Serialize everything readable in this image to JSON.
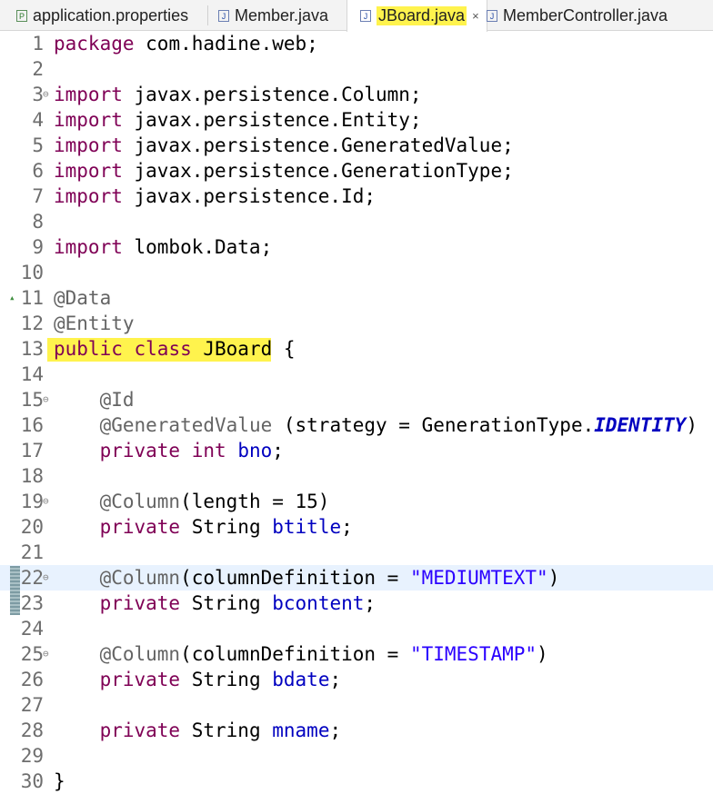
{
  "tabs": [
    {
      "label": "application.properties",
      "icon": "properties-file-icon",
      "icon_glyph": "P"
    },
    {
      "label": "Member.java",
      "icon": "java-file-icon",
      "icon_glyph": "J"
    },
    {
      "label": "JBoard.java",
      "icon": "java-file-icon",
      "icon_glyph": "J",
      "close": "×"
    },
    {
      "label": "MemberController.java",
      "icon": "java-file-icon",
      "icon_glyph": "J"
    }
  ],
  "lines": [
    {
      "n": "1",
      "tokens": [
        [
          "kw",
          "package"
        ],
        [
          "plain",
          " com.hadine.web;"
        ]
      ]
    },
    {
      "n": "2",
      "tokens": []
    },
    {
      "n": "3",
      "fold": "⊖",
      "tokens": [
        [
          "kw",
          "import"
        ],
        [
          "plain",
          " javax.persistence.Column;"
        ]
      ]
    },
    {
      "n": "4",
      "tokens": [
        [
          "kw",
          "import"
        ],
        [
          "plain",
          " javax.persistence.Entity;"
        ]
      ]
    },
    {
      "n": "5",
      "tokens": [
        [
          "kw",
          "import"
        ],
        [
          "plain",
          " javax.persistence.GeneratedValue;"
        ]
      ]
    },
    {
      "n": "6",
      "tokens": [
        [
          "kw",
          "import"
        ],
        [
          "plain",
          " javax.persistence.GenerationType;"
        ]
      ]
    },
    {
      "n": "7",
      "tokens": [
        [
          "kw",
          "import"
        ],
        [
          "plain",
          " javax.persistence.Id;"
        ]
      ]
    },
    {
      "n": "8",
      "tokens": []
    },
    {
      "n": "9",
      "tokens": [
        [
          "kw",
          "import"
        ],
        [
          "plain",
          " lombok.Data;"
        ]
      ]
    },
    {
      "n": "10",
      "tokens": []
    },
    {
      "n": "11",
      "foldUp": "▴",
      "tokens": [
        [
          "ann",
          "@Data"
        ]
      ]
    },
    {
      "n": "12",
      "tokens": [
        [
          "ann",
          "@Entity"
        ]
      ]
    },
    {
      "n": "13",
      "tokens": [
        [
          "kw",
          "public"
        ],
        [
          "plain",
          " "
        ],
        [
          "kw",
          "class"
        ],
        [
          "plain",
          " JBoard {"
        ]
      ]
    },
    {
      "n": "14",
      "tokens": []
    },
    {
      "n": "15",
      "fold": "⊖",
      "tokens": [
        [
          "plain",
          "    "
        ],
        [
          "ann",
          "@Id"
        ]
      ]
    },
    {
      "n": "16",
      "tokens": [
        [
          "plain",
          "    "
        ],
        [
          "ann",
          "@GeneratedValue"
        ],
        [
          "plain",
          " (strategy = GenerationType."
        ],
        [
          "konst",
          "IDENTITY"
        ],
        [
          "plain",
          ")"
        ]
      ]
    },
    {
      "n": "17",
      "tokens": [
        [
          "plain",
          "    "
        ],
        [
          "kw",
          "private"
        ],
        [
          "plain",
          " "
        ],
        [
          "kw",
          "int"
        ],
        [
          "plain",
          " "
        ],
        [
          "field",
          "bno"
        ],
        [
          "plain",
          ";"
        ]
      ]
    },
    {
      "n": "18",
      "tokens": []
    },
    {
      "n": "19",
      "fold": "⊖",
      "tokens": [
        [
          "plain",
          "    "
        ],
        [
          "ann",
          "@Column"
        ],
        [
          "plain",
          "(length = 15)"
        ]
      ]
    },
    {
      "n": "20",
      "tokens": [
        [
          "plain",
          "    "
        ],
        [
          "kw",
          "private"
        ],
        [
          "plain",
          " String "
        ],
        [
          "field",
          "btitle"
        ],
        [
          "plain",
          ";"
        ]
      ]
    },
    {
      "n": "21",
      "tokens": []
    },
    {
      "n": "22",
      "fold": "⊖",
      "current": true,
      "tokens": [
        [
          "plain",
          "    "
        ],
        [
          "ann",
          "@Column"
        ],
        [
          "plain",
          "(columnDefinition = "
        ],
        [
          "str",
          "\"MEDIUMTEXT\""
        ],
        [
          "plain",
          ")"
        ]
      ]
    },
    {
      "n": "23",
      "tokens": [
        [
          "plain",
          "    "
        ],
        [
          "kw",
          "private"
        ],
        [
          "plain",
          " String "
        ],
        [
          "field",
          "bcontent"
        ],
        [
          "plain",
          ";"
        ]
      ]
    },
    {
      "n": "24",
      "tokens": []
    },
    {
      "n": "25",
      "fold": "⊖",
      "tokens": [
        [
          "plain",
          "    "
        ],
        [
          "ann",
          "@Column"
        ],
        [
          "plain",
          "(columnDefinition = "
        ],
        [
          "str",
          "\"TIMESTAMP\""
        ],
        [
          "plain",
          ")"
        ]
      ]
    },
    {
      "n": "26",
      "tokens": [
        [
          "plain",
          "    "
        ],
        [
          "kw",
          "private"
        ],
        [
          "plain",
          " String "
        ],
        [
          "field",
          "bdate"
        ],
        [
          "plain",
          ";"
        ]
      ]
    },
    {
      "n": "27",
      "tokens": []
    },
    {
      "n": "28",
      "tokens": [
        [
          "plain",
          "    "
        ],
        [
          "kw",
          "private"
        ],
        [
          "plain",
          " String "
        ],
        [
          "field",
          "mname"
        ],
        [
          "plain",
          ";"
        ]
      ]
    },
    {
      "n": "29",
      "tokens": []
    },
    {
      "n": "30",
      "tokens": [
        [
          "plain",
          "}"
        ]
      ]
    }
  ],
  "colors": {
    "keyword": "#7f0055",
    "annotation": "#646464",
    "field": "#0000c0",
    "string": "#2a00ff",
    "highlight": "#fff34d",
    "current_line": "#e8f2fe"
  }
}
